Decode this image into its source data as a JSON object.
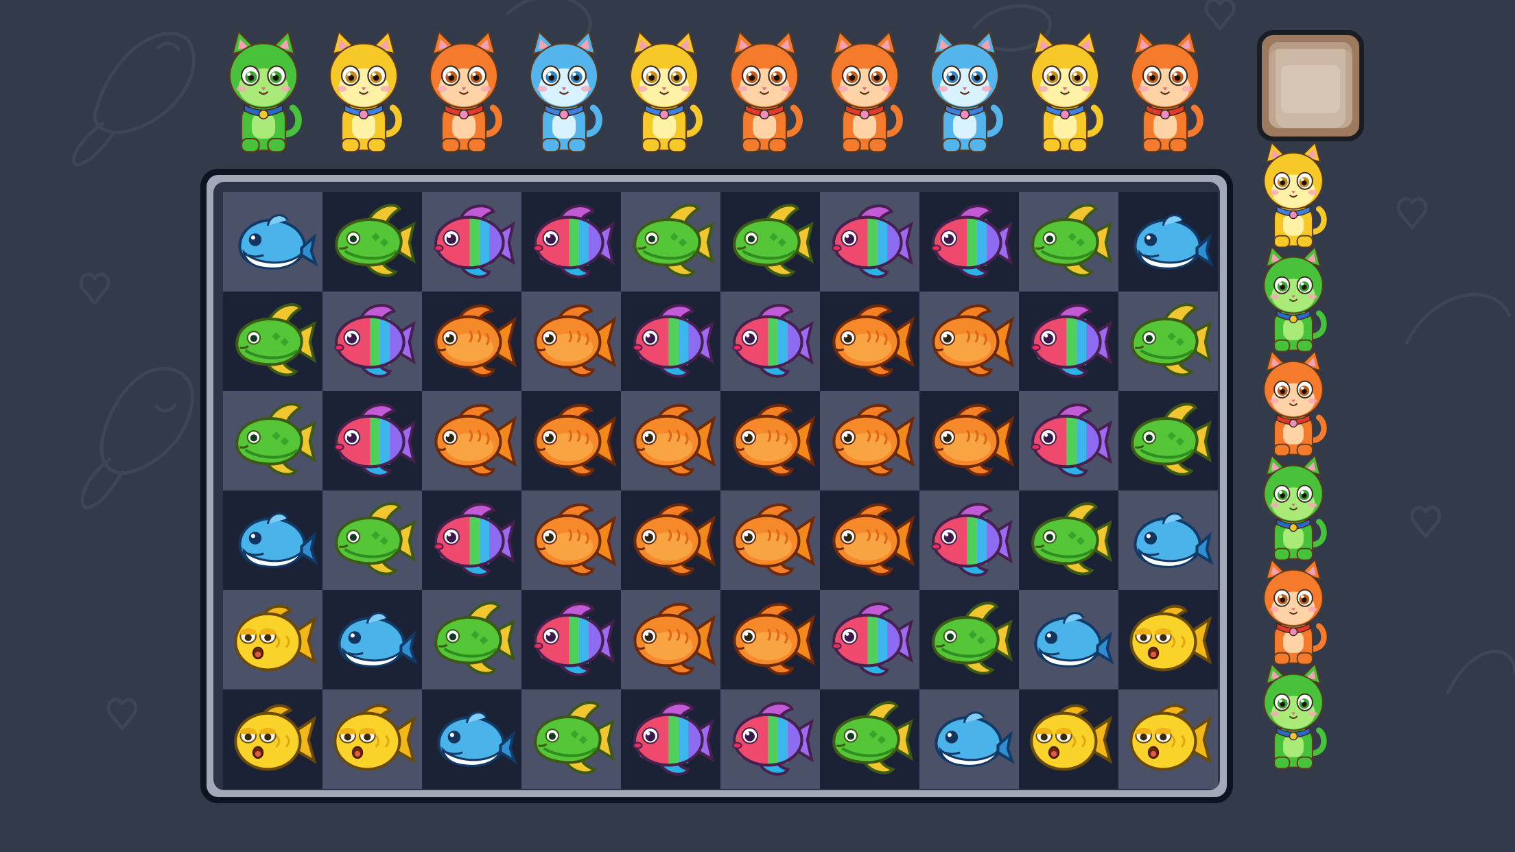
{
  "colors": {
    "background": "#333a4a",
    "tile_dark": "#1b2236",
    "tile_light": "#4a5169",
    "frame_border": "#0f1422",
    "frame_fill": "#a3a9b8",
    "cat_green": "#48c23a",
    "cat_yellow": "#f7c928",
    "cat_orange": "#f57a2c",
    "cat_blue": "#53b5ec"
  },
  "cat_queue": [
    "green",
    "yellow",
    "orange",
    "blue",
    "yellow",
    "orange",
    "orange",
    "blue",
    "yellow",
    "orange"
  ],
  "cat_stack": [
    "yellow",
    "green",
    "orange",
    "green",
    "orange",
    "green"
  ],
  "basket": {
    "state": "empty"
  },
  "board": {
    "rows": 6,
    "cols": 10,
    "tiles": [
      [
        "blue_whale",
        "green_angelfish",
        "rainbow_fish",
        "rainbow_fish",
        "green_angelfish",
        "green_angelfish",
        "rainbow_fish",
        "rainbow_fish",
        "green_angelfish",
        "blue_whale"
      ],
      [
        "green_angelfish",
        "rainbow_fish",
        "orange_goldfish",
        "orange_goldfish",
        "rainbow_fish",
        "rainbow_fish",
        "orange_goldfish",
        "orange_goldfish",
        "rainbow_fish",
        "green_angelfish"
      ],
      [
        "green_angelfish",
        "rainbow_fish",
        "orange_goldfish",
        "orange_goldfish",
        "orange_goldfish",
        "orange_goldfish",
        "orange_goldfish",
        "orange_goldfish",
        "rainbow_fish",
        "green_angelfish"
      ],
      [
        "blue_whale",
        "green_angelfish",
        "rainbow_fish",
        "orange_goldfish",
        "orange_goldfish",
        "orange_goldfish",
        "orange_goldfish",
        "rainbow_fish",
        "green_angelfish",
        "blue_whale"
      ],
      [
        "yellow_pufferfish",
        "blue_whale",
        "green_angelfish",
        "rainbow_fish",
        "orange_goldfish",
        "orange_goldfish",
        "rainbow_fish",
        "green_angelfish",
        "blue_whale",
        "yellow_pufferfish"
      ],
      [
        "yellow_pufferfish",
        "yellow_pufferfish",
        "blue_whale",
        "green_angelfish",
        "rainbow_fish",
        "rainbow_fish",
        "green_angelfish",
        "blue_whale",
        "yellow_pufferfish",
        "yellow_pufferfish"
      ]
    ]
  }
}
